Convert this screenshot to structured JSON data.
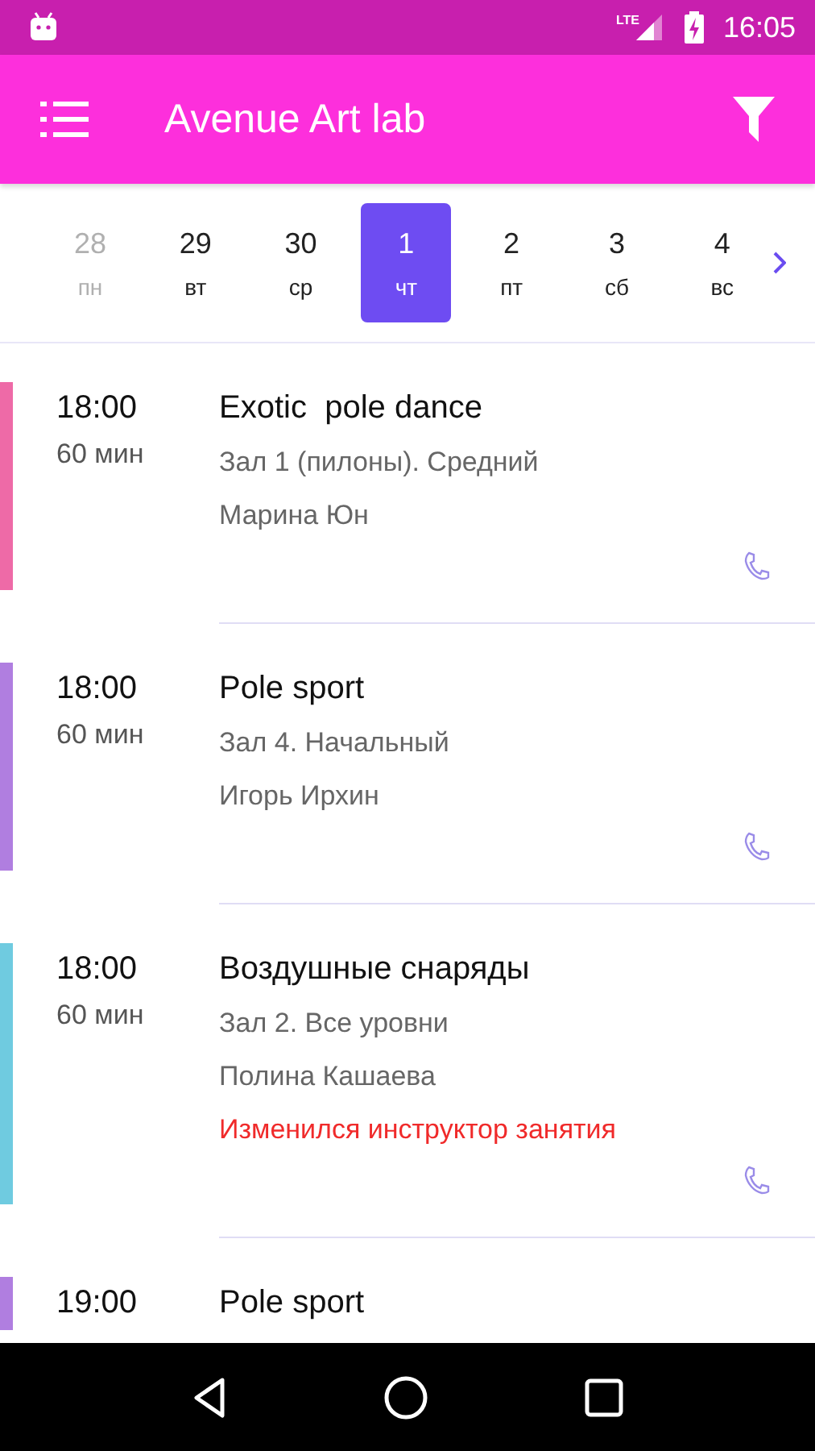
{
  "status_bar": {
    "time": "16:05",
    "network": "LTE"
  },
  "app_bar": {
    "title": "Avenue Art lab"
  },
  "days": [
    {
      "date": "28",
      "weekday": "пн",
      "selected": false,
      "disabled": true
    },
    {
      "date": "29",
      "weekday": "вт",
      "selected": false,
      "disabled": false
    },
    {
      "date": "30",
      "weekday": "ср",
      "selected": false,
      "disabled": false
    },
    {
      "date": "1",
      "weekday": "чт",
      "selected": true,
      "disabled": false
    },
    {
      "date": "2",
      "weekday": "пт",
      "selected": false,
      "disabled": false
    },
    {
      "date": "3",
      "weekday": "сб",
      "selected": false,
      "disabled": false
    },
    {
      "date": "4",
      "weekday": "вс",
      "selected": false,
      "disabled": false
    }
  ],
  "classes": [
    {
      "time": "18:00",
      "duration": "60 мин",
      "title": "Exotic  pole dance",
      "hall": "Зал 1 (пилоны). Средний",
      "instructor": "Марина Юн",
      "color": "#ee6aa7"
    },
    {
      "time": "18:00",
      "duration": "60 мин",
      "title": "Pole sport",
      "hall": "Зал 4. Начальный",
      "instructor": "Игорь Ирхин",
      "color": "#b07ee0"
    },
    {
      "time": "18:00",
      "duration": "60 мин",
      "title": "Воздушные снаряды",
      "hall": "Зал 2. Все уровни",
      "instructor": "Полина Кашаева",
      "notice": "Изменился инструктор занятия",
      "color": "#6fcbe0"
    },
    {
      "time": "19:00",
      "title": "Pole sport",
      "color": "#b07ee0"
    }
  ]
}
